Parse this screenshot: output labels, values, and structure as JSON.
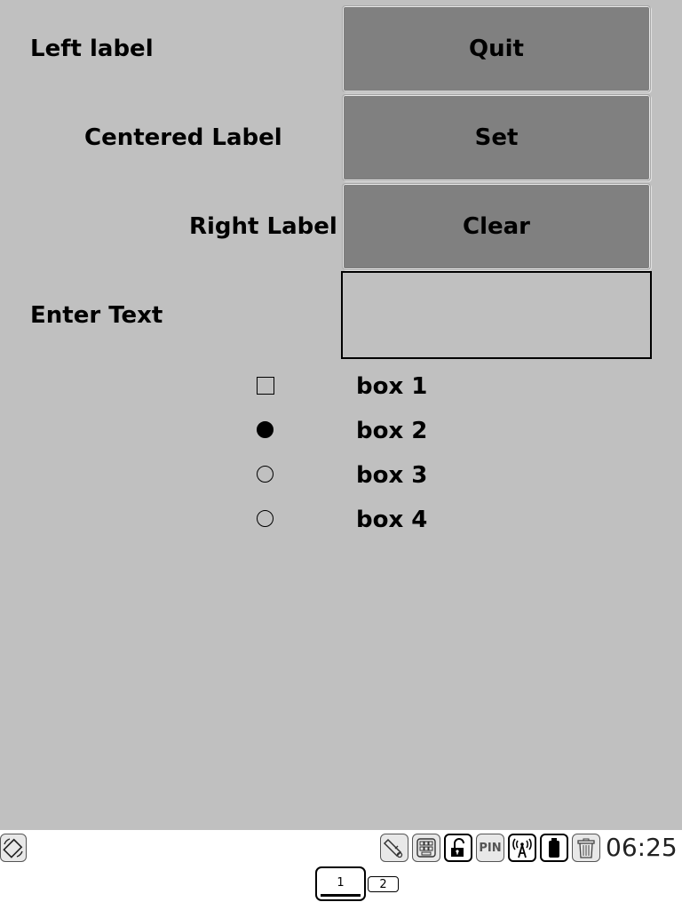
{
  "form": {
    "rows": [
      {
        "label": "Left label",
        "button": "Quit"
      },
      {
        "label": "Centered Label",
        "button": "Set"
      },
      {
        "label": "Right Label",
        "button": "Clear"
      }
    ],
    "text_entry": {
      "label": "Enter Text",
      "value": "",
      "placeholder": ""
    }
  },
  "options": [
    {
      "label": "box 1",
      "control": "checkbox",
      "checked": false
    },
    {
      "label": "box 2",
      "control": "radio",
      "checked": true
    },
    {
      "label": "box 3",
      "control": "radio",
      "checked": false
    },
    {
      "label": "box 4",
      "control": "radio",
      "checked": false
    }
  ],
  "taskbar": {
    "left_icon": "rotate-screen-icon",
    "tray_icons": [
      "usb-device-icon",
      "keyboard-icon",
      "unlock-icon",
      "pin-icon",
      "wireless-icon",
      "battery-icon",
      "trash-icon"
    ],
    "pin_text": "PIN",
    "clock": "06:25",
    "pages": [
      "1",
      "2"
    ]
  }
}
